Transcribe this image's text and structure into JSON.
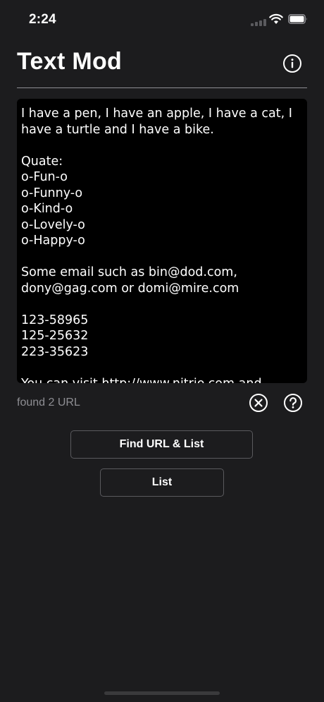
{
  "status_bar": {
    "time": "2:24"
  },
  "header": {
    "title": "Text Mod",
    "info_icon": "info-circle-icon"
  },
  "editor": {
    "text": "I have a pen, I have an apple, I have a cat, I have a turtle and I have a bike.\n\nQuate:\no-Fun-o\no-Funny-o\no-Kind-o\no-Lovely-o\no-Happy-o\n\nSome email such as bin@dod.com, dony@gag.com or domi@mire.com\n\n123-58965\n125-25632\n223-35623\n\nYou can visit http://www.nitrio.com and"
  },
  "result": {
    "status": "found 2 URL",
    "clear_icon": "clear-circle-icon",
    "help_icon": "help-circle-icon"
  },
  "actions": {
    "find_url_list_label": "Find URL & List",
    "list_label": "List"
  },
  "colors": {
    "background": "#1c1c1e",
    "text_area": "#000000",
    "secondary_text": "#8e8e93",
    "button_border": "#5a5a5e"
  }
}
